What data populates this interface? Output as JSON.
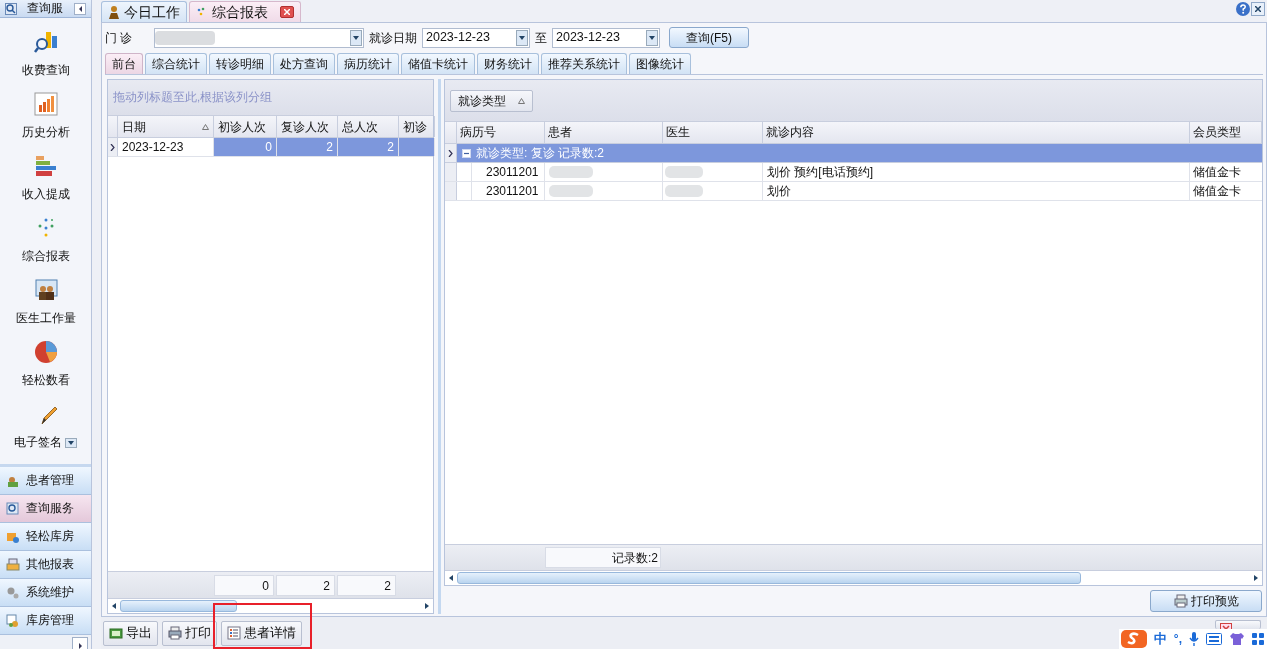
{
  "sidebar": {
    "title": "查询服",
    "items": [
      {
        "label": "收费查询",
        "dropdown": false
      },
      {
        "label": "历史分析",
        "dropdown": false
      },
      {
        "label": "收入提成",
        "dropdown": false
      },
      {
        "label": "综合报表",
        "dropdown": false
      },
      {
        "label": "医生工作量",
        "dropdown": false
      },
      {
        "label": "轻松数看",
        "dropdown": false
      },
      {
        "label": "电子签名",
        "dropdown": true
      }
    ],
    "groups": [
      {
        "label": "患者管理",
        "selected": false
      },
      {
        "label": "查询服务",
        "selected": true
      },
      {
        "label": "轻松库房",
        "selected": false
      },
      {
        "label": "其他报表",
        "selected": false
      },
      {
        "label": "系统维护",
        "selected": false
      },
      {
        "label": "库房管理",
        "selected": false
      }
    ]
  },
  "tabs": [
    {
      "label": "今日工作",
      "selected": false,
      "closable": false
    },
    {
      "label": "综合报表",
      "selected": true,
      "closable": true
    }
  ],
  "filter": {
    "clinic_label": "门 诊",
    "date_label": "就诊日期",
    "date_from": "2023-12-23",
    "to_label": "至",
    "date_to": "2023-12-23",
    "query_button": "查询(F5)"
  },
  "sub_tabs": [
    {
      "label": "前台",
      "selected": true
    },
    {
      "label": "综合统计",
      "selected": false
    },
    {
      "label": "转诊明细",
      "selected": false
    },
    {
      "label": "处方查询",
      "selected": false
    },
    {
      "label": "病历统计",
      "selected": false
    },
    {
      "label": "储值卡统计",
      "selected": false
    },
    {
      "label": "财务统计",
      "selected": false
    },
    {
      "label": "推荐关系统计",
      "selected": false
    },
    {
      "label": "图像统计",
      "selected": false
    }
  ],
  "left_grid": {
    "group_hint": "拖动列标题至此,根据该列分组",
    "columns": [
      "日期",
      "初诊人次",
      "复诊人次",
      "总人次",
      "初诊"
    ],
    "rows": [
      {
        "cells": [
          "2023-12-23",
          "0",
          "2",
          "2",
          ""
        ],
        "selected": true
      }
    ],
    "totals": [
      "0",
      "2",
      "2"
    ]
  },
  "right_grid": {
    "group_chip": "就诊类型",
    "columns": [
      "病历号",
      "患者",
      "医生",
      "就诊内容",
      "会员类型"
    ],
    "group_row": {
      "label": "就诊类型: 复诊 记录数:2",
      "expanded": true
    },
    "rows": [
      {
        "record_no": "23011201",
        "content": "划价 预约[电话预约]",
        "member_type": "储值金卡"
      },
      {
        "record_no": "23011201",
        "content": "划价",
        "member_type": "储值金卡"
      }
    ],
    "footer": "记录数:2"
  },
  "print_preview_button": "打印预览",
  "toolbar": [
    "导出",
    "打印",
    "患者详情"
  ],
  "ime": {
    "language": "中",
    "punctuation": "°,"
  }
}
